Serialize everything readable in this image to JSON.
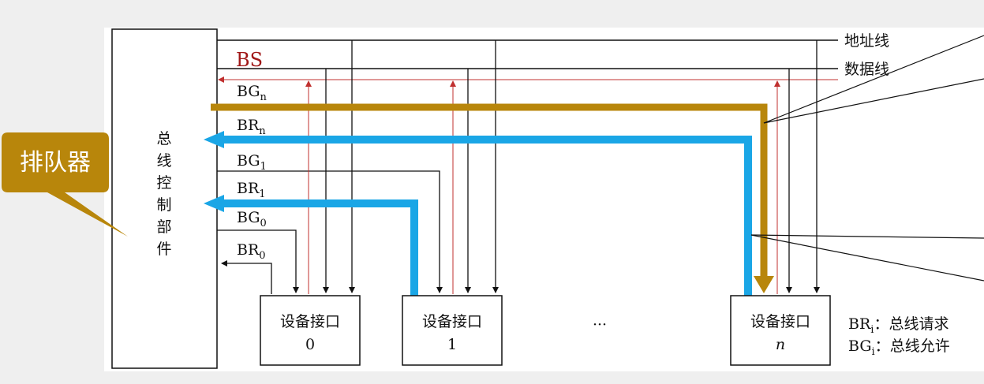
{
  "controller": {
    "chars": [
      "总",
      "线",
      "控",
      "制",
      "部",
      "件"
    ]
  },
  "bus_lines": {
    "address": "地址线",
    "data": "数据线",
    "bs": "BS"
  },
  "signals": {
    "bgn": {
      "base": "BG",
      "sub": "n"
    },
    "brn": {
      "base": "BR",
      "sub": "n"
    },
    "bg1": {
      "base": "BG",
      "sub": "1"
    },
    "br1": {
      "base": "BR",
      "sub": "1"
    },
    "bg0": {
      "base": "BG",
      "sub": "0"
    },
    "br0": {
      "base": "BR",
      "sub": "0"
    }
  },
  "devices": [
    {
      "title": "设备接口",
      "index": "0"
    },
    {
      "title": "设备接口",
      "index": "1"
    },
    {
      "title": "设备接口",
      "index": "n"
    }
  ],
  "ellipsis": "···",
  "legend": {
    "br": {
      "base": "BR",
      "sub": "i",
      "sep": "：",
      "text": "总线请求"
    },
    "bg": {
      "base": "BG",
      "sub": "i",
      "sep": "：",
      "text": "总线允许"
    }
  },
  "callout": {
    "text": "排队器"
  },
  "colors": {
    "gold": "#b8860b",
    "blue": "#1aa6e6",
    "red": "#c0302f",
    "callout": "#b8860b"
  }
}
